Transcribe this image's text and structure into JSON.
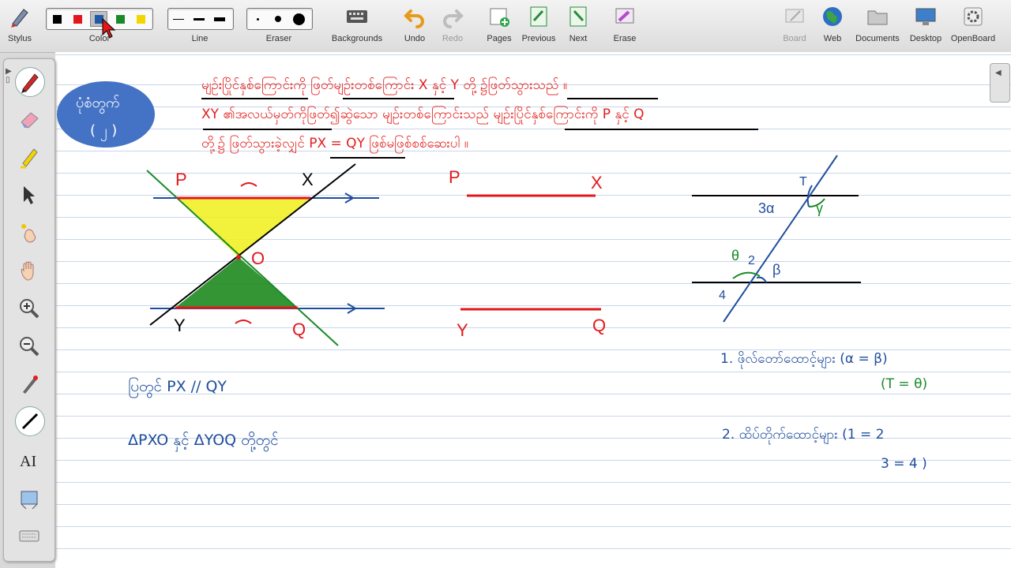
{
  "toolbar": {
    "stylus": "Stylus",
    "color": "Color",
    "line": "Line",
    "eraser": "Eraser",
    "backgrounds": "Backgrounds",
    "undo": "Undo",
    "redo": "Redo",
    "pages": "Pages",
    "previous": "Previous",
    "next": "Next",
    "erase": "Erase",
    "board": "Board",
    "web": "Web",
    "documents": "Documents",
    "desktop": "Desktop",
    "openboard": "OpenBoard"
  },
  "colors": [
    "#000000",
    "#e3171b",
    "#1f5aa6",
    "#1a8a28",
    "#f2d600"
  ],
  "selected_color": "#1f5aa6",
  "sidebar_tools": [
    "pen-icon",
    "eraser-icon",
    "highlighter-icon",
    "selector-icon",
    "laser-pointer-icon",
    "hand-icon",
    "zoom-in-icon",
    "zoom-out-icon",
    "pointer-pen-icon",
    "line-icon",
    "text-icon",
    "capture-icon",
    "keyboard-icon"
  ],
  "board": {
    "badge_line1": "ပုံစံတွက်",
    "badge_line2": "( ၂ )",
    "problem_line1": "မျဉ်းပြိုင်နှစ်ကြောင်းကို ဖြတ်မျဉ်းတစ်ကြောင်း X နှင့် Y တို့ ၌ဖြတ်သွားသည် ။",
    "problem_line2": "XY ၏အလယ်မှတ်ကိုဖြတ်၍ဆွဲသော မျဉ်းတစ်ကြောင်းသည် မျဉ်းပြိုင်နှစ်ကြောင်းကို P နှင့် Q",
    "problem_line3": "တို့၌ ဖြတ်သွားခဲ့လျှင် PX = QY ဖြစ်မဖြစ်စစ်ဆေးပါ ။",
    "fig1": {
      "p": "P",
      "x": "X",
      "o": "O",
      "y": "Y",
      "q": "Q"
    },
    "fig2": {
      "p": "P",
      "x": "X",
      "y": "Y",
      "q": "Q"
    },
    "fig3": {
      "t": "T",
      "a": "3α",
      "g": "γ",
      "th": "θ",
      "two": "2",
      "b": "β",
      "four": "4"
    },
    "note_px_qy": "ပြတွင် PX // QY",
    "note_triangles": "ΔPXO နှင့် ΔYOQ တို့တွင်",
    "note1_a": "1. ဖိုလ်တော်ထောင့်များ (α = β)",
    "note1_b": "(T = θ)",
    "note2_a": "2. ထိပ်တိုက်ထောင့်များ (1 = 2",
    "note2_b": "3 = 4 )"
  }
}
